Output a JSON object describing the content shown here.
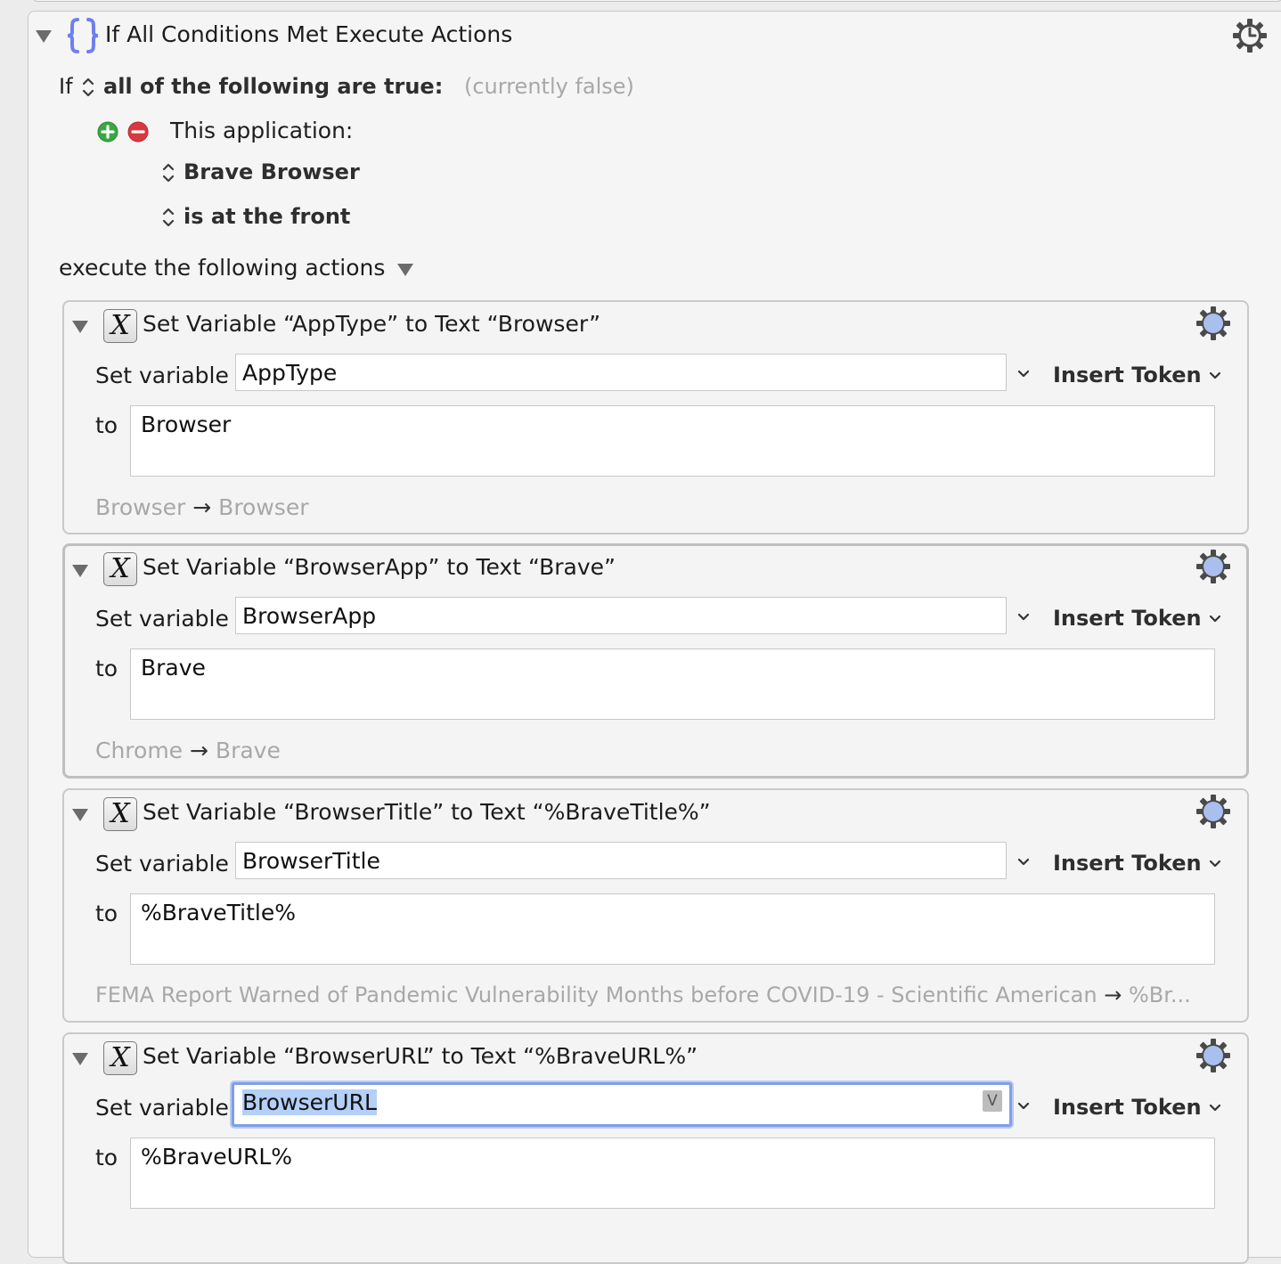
{
  "condition_action": {
    "title": "If All Conditions Met Execute Actions",
    "if_label": "If",
    "match_mode": "all of the following are true:",
    "status": "(currently false)",
    "condition": {
      "type_label": "This application:",
      "application": "Brave Browser",
      "state": "is at the front"
    },
    "execute_label": "execute the following actions"
  },
  "actions": [
    {
      "title": "Set Variable “AppType” to Text “Browser”",
      "set_variable_label": "Set variable",
      "variable": "AppType",
      "to_label": "to",
      "value": "Browser",
      "insert_token": "Insert Token",
      "preview_from": "Browser",
      "preview_arrow": "→",
      "preview_to": "Browser"
    },
    {
      "title": "Set Variable “BrowserApp” to Text “Brave”",
      "set_variable_label": "Set variable",
      "variable": "BrowserApp",
      "to_label": "to",
      "value": "Brave",
      "insert_token": "Insert Token",
      "preview_from": "Chrome",
      "preview_arrow": "→",
      "preview_to": "Brave"
    },
    {
      "title": "Set Variable “BrowserTitle” to Text “%BraveTitle%”",
      "set_variable_label": "Set variable",
      "variable": "BrowserTitle",
      "to_label": "to",
      "value": "%BraveTitle%",
      "insert_token": "Insert Token",
      "preview_from": "FEMA Report Warned of Pandemic Vulnerability Months before COVID-19 - Scientific American",
      "preview_arrow": "→",
      "preview_to": "%Br..."
    },
    {
      "title": "Set Variable “BrowserURL” to Text “%BraveURL%”",
      "set_variable_label": "Set variable",
      "variable": "BrowserURL",
      "variable_badge": "V",
      "to_label": "to",
      "value": "%BraveURL%",
      "insert_token": "Insert Token"
    }
  ],
  "colors": {
    "accent_focus": "#7f9fe6",
    "selection": "#b4cff8",
    "add_button": "#3aa744",
    "remove_button": "#d8393f",
    "braces_icon": "#6f7ff0",
    "gear_fill": "#a9c0ee"
  },
  "icons": {
    "outer": "braces-icon",
    "action": "variable-x-icon",
    "settings": "gear-icon",
    "add": "plus-circle-icon",
    "remove": "minus-circle-icon"
  }
}
